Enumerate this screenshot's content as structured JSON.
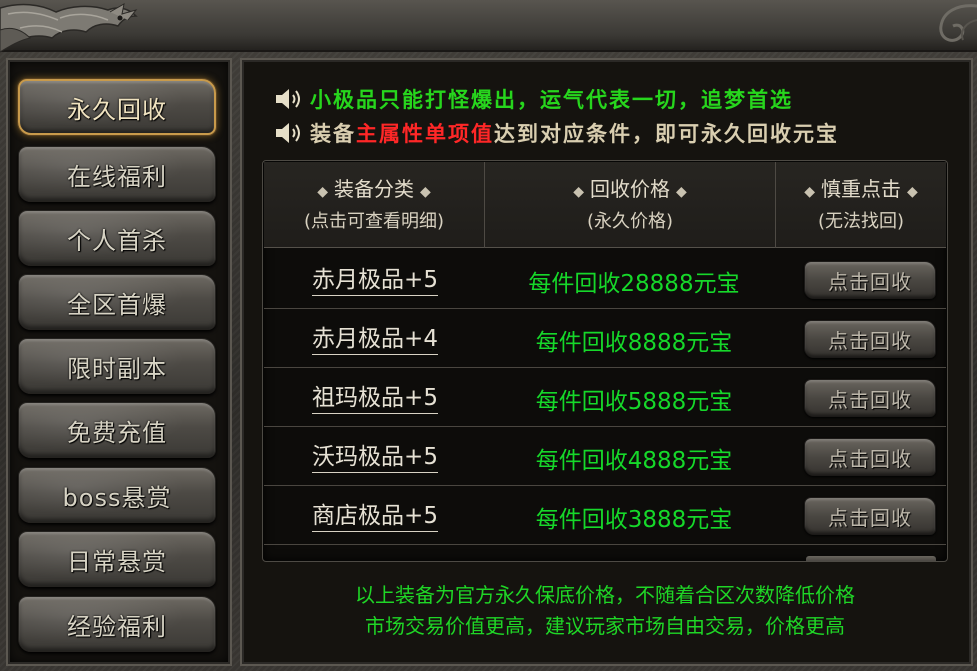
{
  "sidebar": {
    "items": [
      {
        "label": "永久回收",
        "active": true
      },
      {
        "label": "在线福利",
        "active": false
      },
      {
        "label": "个人首杀",
        "active": false
      },
      {
        "label": "全区首爆",
        "active": false
      },
      {
        "label": "限时副本",
        "active": false
      },
      {
        "label": "免费充值",
        "active": false
      },
      {
        "label": "boss悬赏",
        "active": false
      },
      {
        "label": "日常悬赏",
        "active": false
      },
      {
        "label": "经验福利",
        "active": false
      }
    ]
  },
  "notices": {
    "line1": "小极品只能打怪爆出，运气代表一切，追梦首选",
    "line2_before": "装备",
    "line2_highlight": "主属性单项值",
    "line2_after": "达到对应条件，即可永久回收元宝",
    "icon": "speaker-icon"
  },
  "table": {
    "headers": [
      {
        "title": "装备分类",
        "sub": "(点击可查看明细)"
      },
      {
        "title": "回收价格",
        "sub": "(永久价格)"
      },
      {
        "title": "慎重点击",
        "sub": "(无法找回)"
      }
    ],
    "header_marker": "◆",
    "button_label": "点击回收",
    "rows": [
      {
        "name": "赤月极品+5",
        "price": "每件回收28888元宝"
      },
      {
        "name": "赤月极品+4",
        "price": "每件回收8888元宝"
      },
      {
        "name": "祖玛极品+5",
        "price": "每件回收5888元宝"
      },
      {
        "name": "沃玛极品+5",
        "price": "每件回收4888元宝"
      },
      {
        "name": "商店极品+5",
        "price": "每件回收3888元宝"
      }
    ]
  },
  "footer": {
    "line1": "以上装备为官方永久保底价格，不随着合区次数降低价格",
    "line2": "市场交易价值更高，建议玩家市场自由交易，价格更高"
  },
  "colors": {
    "notice_green": "#27d61d",
    "highlight_red": "#ff2727",
    "price_green": "#16d82a",
    "active_border": "#c89a4b"
  }
}
